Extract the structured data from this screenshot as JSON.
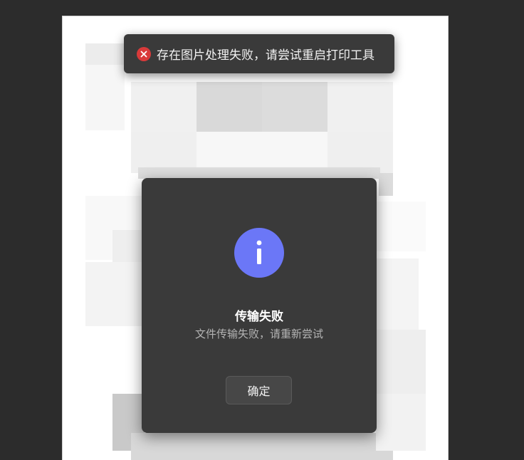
{
  "toast": {
    "icon": "error-circle-icon",
    "message": "存在图片处理失败，请尝试重启打印工具",
    "icon_color": "#d93a3a"
  },
  "dialog": {
    "icon": "info-icon",
    "icon_color": "#6b77f7",
    "title": "传输失败",
    "message": "文件传输失败，请重新尝试",
    "confirm_label": "确定"
  }
}
